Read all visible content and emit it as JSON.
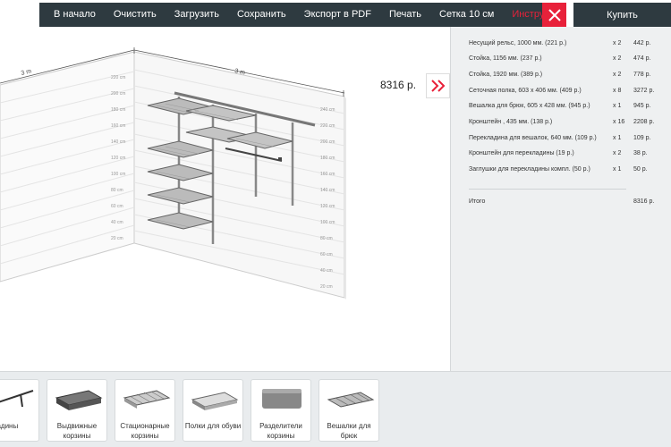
{
  "topbar": {
    "items": [
      "В начало",
      "Очистить",
      "Загрузить",
      "Сохранить",
      "Экспорт в PDF",
      "Печать",
      "Сетка 10 см",
      "Инструкция"
    ],
    "buy_label": "Купить"
  },
  "scene": {
    "total_price": "8316 р.",
    "left_wall_label": "3 m",
    "right_wall_label": "3 m",
    "left_scale": [
      "220 cm",
      "200 cm",
      "180 cm",
      "160 cm",
      "140 cm",
      "120 cm",
      "100 cm",
      "80 cm",
      "60 cm",
      "40 cm",
      "20 cm"
    ],
    "right_scale": [
      "240 cm",
      "220 cm",
      "200 cm",
      "180 cm",
      "160 cm",
      "140 cm",
      "120 cm",
      "100 cm",
      "80 cm",
      "60 cm",
      "40 cm",
      "20 cm"
    ]
  },
  "spec": {
    "items": [
      {
        "name": "Несущий рельс, 1000 мм. (221 р.)",
        "qty": "x 2",
        "price": "442 р."
      },
      {
        "name": "Стойка, 1156 мм. (237 р.)",
        "qty": "x 2",
        "price": "474 р."
      },
      {
        "name": "Стойка, 1920 мм. (389 р.)",
        "qty": "x 2",
        "price": "778 р."
      },
      {
        "name": "Сеточная полка, 603 х 406 мм. (409 р.)",
        "qty": "x 8",
        "price": "3272 р."
      },
      {
        "name": "Вешалка для брюк, 605 х 428 мм. (945 р.)",
        "qty": "x 1",
        "price": "945 р."
      },
      {
        "name": "Кронштейн , 435 мм. (138 р.)",
        "qty": "x 16",
        "price": "2208 р."
      },
      {
        "name": "Перекладина для вешалок, 640 мм. (109 р.)",
        "qty": "x 1",
        "price": "109 р."
      },
      {
        "name": "Кронштейн для перекладины (19 р.)",
        "qty": "x 2",
        "price": "38 р."
      },
      {
        "name": "Заглушки для перекладины компл. (50 р.)",
        "qty": "x 1",
        "price": "50 р."
      }
    ],
    "total_label": "Итого",
    "total_value": "8316 р."
  },
  "catalog": {
    "items": [
      {
        "label": "екладины",
        "icon": "rail-icon"
      },
      {
        "label": "Выдвижные корзины",
        "icon": "basket-icon"
      },
      {
        "label": "Стационарные корзины",
        "icon": "mesh-basket-icon"
      },
      {
        "label": "Полки для обуви",
        "icon": "shoe-shelf-icon"
      },
      {
        "label": "Разделители корзины",
        "icon": "divider-icon"
      },
      {
        "label": "Вешалки для брюк",
        "icon": "trouser-rack-icon"
      }
    ]
  }
}
